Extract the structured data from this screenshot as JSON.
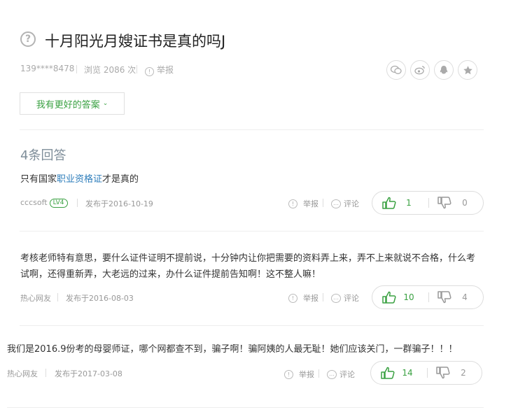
{
  "question": {
    "title": "十月阳光月嫂证书是真的吗J",
    "user": "139****8478",
    "views": "浏览 2086 次",
    "report": "举报"
  },
  "share_icons": [
    "wechat-icon",
    "weibo-icon",
    "qq-icon",
    "favorite-icon"
  ],
  "better_answer_label": "我有更好的答案",
  "answer_count": "4条回答",
  "answers": [
    {
      "text_before": "只有国家",
      "text_link": "职业资格证",
      "text_after": "才是真的",
      "user": "cccsoft",
      "level": "LV4",
      "date": "发布于2016-10-19",
      "report": "举报",
      "comment": "评论",
      "up": "1",
      "down": "0"
    },
    {
      "text_line1": "考核老师特有意思，要什么证件证明不提前说，十分钟内让你把需要的资料弄上来，弄不上来就说不合格，什么考",
      "text_line2": "试啊，还得重新弄，大老远的过来，办什么证件提前告知啊！这不整人嘛！",
      "user": "热心网友",
      "date": "发布于2016-08-03",
      "report": "举报",
      "comment": "评论",
      "up": "10",
      "down": "4"
    },
    {
      "text": "我们是2016.9份考的母婴师证，哪个网都查不到，骗子啊！骗阿姨的人最无耻！她们应该关门，一群骗子！！！",
      "user": "热心网友",
      "date": "发布于2017-03-08",
      "report": "举报",
      "comment": "评论",
      "up": "14",
      "down": "2"
    }
  ],
  "colors": {
    "green": "#3aa142",
    "link": "#2d7dbb",
    "muted": "#999999"
  }
}
